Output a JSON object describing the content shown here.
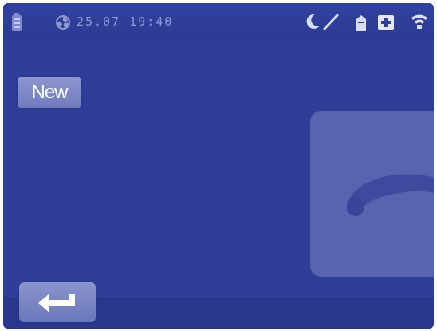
{
  "status_bar": {
    "datetime": "25.07 19:40",
    "icons": [
      "battery-icon",
      "fan-icon",
      "moon-icon",
      "pen-icon",
      "doc-icon",
      "plus-icon",
      "wifi-icon"
    ]
  },
  "actions": {
    "new_label": "New",
    "back_icon": "return-icon",
    "call_icon": "handset-icon"
  },
  "colors": {
    "background": "#2f3e96",
    "button": "#7b86c6",
    "call_panel": "#5964b1"
  }
}
